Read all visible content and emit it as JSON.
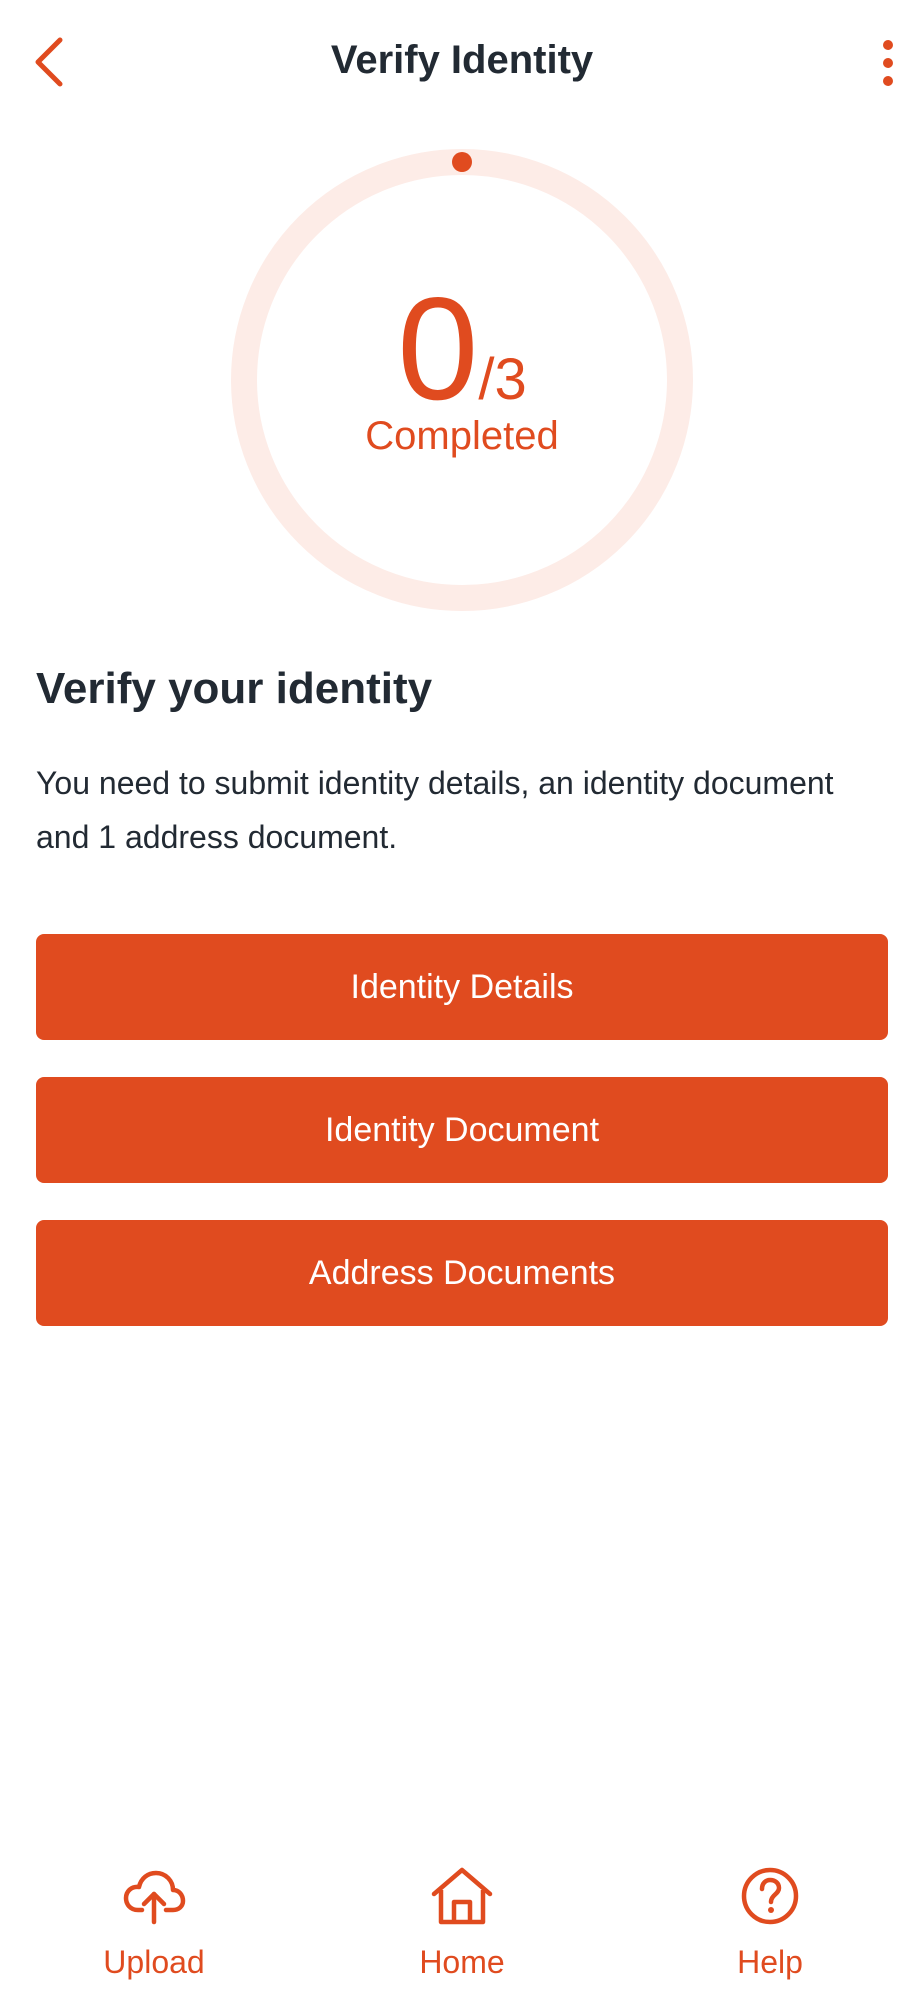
{
  "header": {
    "title": "Verify Identity",
    "back_icon": "chevron-left-icon",
    "menu_icon": "more-vertical-icon"
  },
  "progress": {
    "completed": "0",
    "total_text": "/3",
    "label": "Completed",
    "fraction": 0
  },
  "intro": {
    "title": "Verify your identity",
    "description": "You need to submit identity details, an identity document and 1 address document."
  },
  "actions": [
    {
      "label": "Identity Details"
    },
    {
      "label": "Identity Document"
    },
    {
      "label": "Address Documents"
    }
  ],
  "bottom_nav": {
    "items": [
      {
        "label": "Upload",
        "icon": "cloud-upload-icon"
      },
      {
        "label": "Home",
        "icon": "home-icon"
      },
      {
        "label": "Help",
        "icon": "help-circle-icon"
      }
    ]
  },
  "colors": {
    "accent": "#e04b1f",
    "ring_track": "#fdece7",
    "text": "#222a33",
    "background": "#ffffff"
  }
}
